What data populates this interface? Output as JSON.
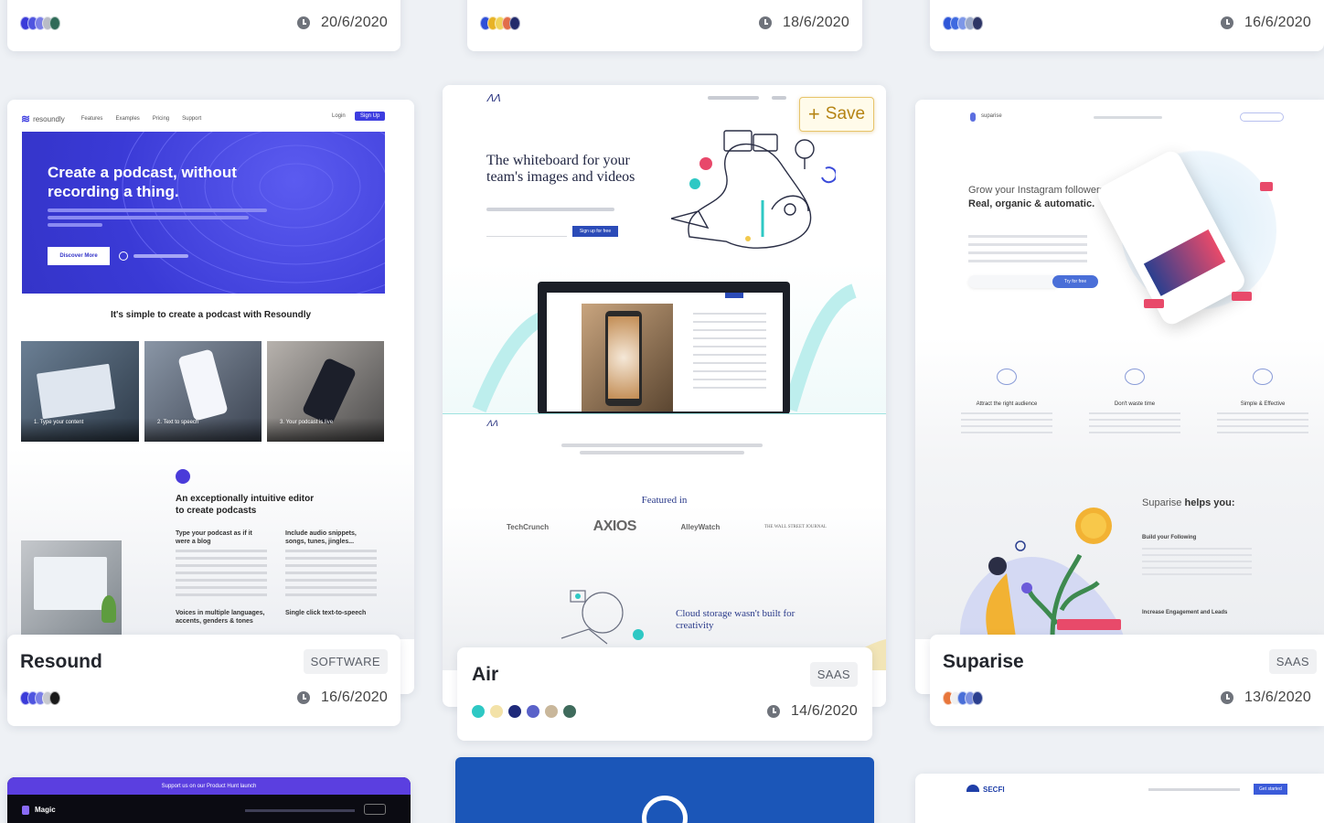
{
  "top_cards": [
    {
      "date": "20/6/2020",
      "colors": [
        "#3b3bd9",
        "#4f55e0",
        "#7a7fe6",
        "#b9bcc6",
        "#2f6b58"
      ]
    },
    {
      "date": "18/6/2020",
      "colors": [
        "#2e4fd8",
        "#e8b326",
        "#f0d35a",
        "#e26d4a",
        "#222a6b"
      ]
    },
    {
      "date": "16/6/2020",
      "colors": [
        "#2e56d8",
        "#3f6ae0",
        "#7d97e8",
        "#9aa8c8",
        "#2d3566"
      ]
    }
  ],
  "cards": [
    {
      "title": "Resound",
      "tag": "SOFTWARE",
      "date": "16/6/2020",
      "colors": [
        "#3b3bd9",
        "#4f55e0",
        "#7a7fe6",
        "#c7c9cf",
        "#1a1a1a"
      ],
      "shot": {
        "brand": "resoundly",
        "headline": "Create a podcast, without recording a thing.",
        "cta": "Discover More",
        "section": "It's simple to create a podcast with Resoundly",
        "steps": [
          "1. Type your content",
          "2. Text to speech",
          "3. Your podcast is live"
        ],
        "feature": "An exceptionally intuitive editor to create podcasts",
        "feat_a": "Type your podcast as if it were a blog",
        "feat_b": "Include audio snippets, songs, tunes, jingles...",
        "feat_c": "Voices in multiple languages, accents, genders & tones",
        "feat_d": "Single click text-to-speech",
        "login": "Login",
        "signup": "Sign Up",
        "nav": [
          "Features",
          "Examples",
          "Pricing",
          "Support"
        ]
      }
    },
    {
      "title": "Air",
      "tag": "SAAS",
      "date": "14/6/2020",
      "colors": [
        "#2ec8c4",
        "#f3e2a8",
        "#1f2a7a",
        "#5a62c9",
        "#c9b79b",
        "#3f6b5c"
      ],
      "shot": {
        "headline": "The whiteboard for your team's images and videos",
        "cta": "Sign up for free",
        "featured": "Featured in",
        "press": [
          "TechCrunch",
          "AXIOS",
          "AlleyWatch",
          "THE WALL STREET JOURNAL"
        ],
        "cloud": "Cloud storage wasn't built for creativity"
      }
    },
    {
      "title": "Suparise",
      "tag": "SAAS",
      "date": "13/6/2020",
      "colors": [
        "#e8763b",
        "#f0f0f0",
        "#4a6fd8",
        "#7b8fe0",
        "#2b3f8f"
      ],
      "shot": {
        "brand": "suparise",
        "headline_light": "Grow your Instagram followers.",
        "headline_bold": "Real, organic & automatic.",
        "cta": "Try for free",
        "features": [
          "Attract the right audience",
          "Don't waste time",
          "Simple & Effective"
        ],
        "helps_light": "Suparise",
        "helps_bold": "helps you:",
        "item_a": "Build your Following",
        "item_b": "Increase Engagement and Leads"
      }
    }
  ],
  "save": {
    "label": "Save"
  },
  "bottom": {
    "magic_brand": "Magic",
    "magic_banner": "Support us on our Product Hunt launch",
    "secfi_brand": "SECFI",
    "secfi_cta": "Get started"
  }
}
